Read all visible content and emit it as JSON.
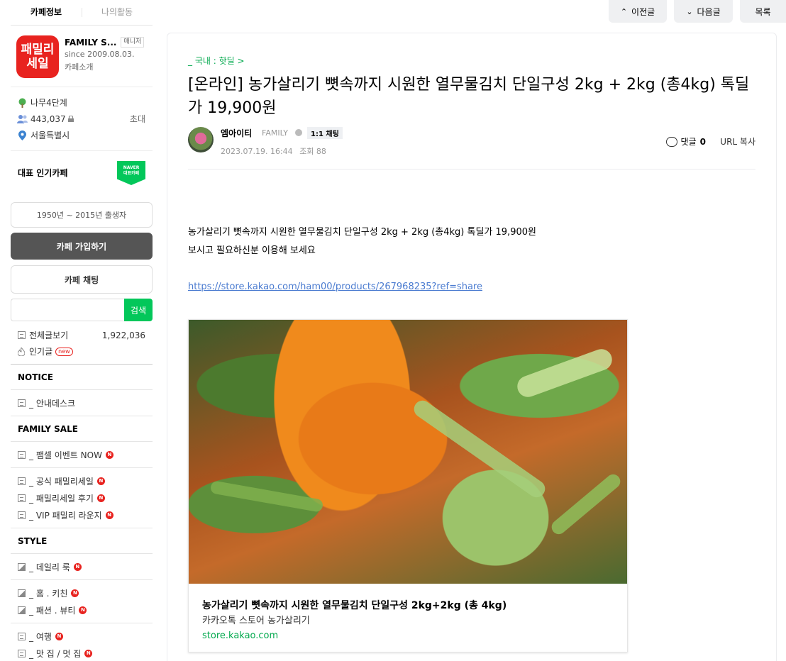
{
  "sidebar": {
    "tabs": [
      "카페정보",
      "나의활동"
    ],
    "cafe": {
      "thumb_lines": [
        "패밀리",
        "세일"
      ],
      "name": "FAMILY S...",
      "badge": "매니저",
      "since": "since 2009.08.03.",
      "intro": "카페소개"
    },
    "stats": {
      "level": "나무4단계",
      "members": "443,037",
      "invite": "초대",
      "location": "서울특별시"
    },
    "rep_label": "대표 인기카페",
    "naver_badge": [
      "NAVER",
      "대표카페"
    ],
    "birth_filter": "1950년 ~ 2015년 출생자",
    "join_label": "카페 가입하기",
    "chat_label": "카페 채팅",
    "search_button": "검색",
    "all_posts_label": "전체글보기",
    "all_posts_count": "1,922,036",
    "popular_label": "인기글",
    "new_badge": "new",
    "sections": [
      {
        "title": "NOTICE"
      },
      {
        "title": "FAMILY SALE"
      },
      {
        "title": "STYLE"
      }
    ],
    "notice_items": [
      "_ 안내데스크"
    ],
    "sale_items_1": [
      "_ 팸셀 이벤트 NOW"
    ],
    "sale_items_2": [
      "_ 공식 패밀리세일",
      "_ 패밀리세일 후기",
      "_ VIP 패밀리 라운지"
    ],
    "style_items_1": [
      "_ 데일리 룩"
    ],
    "style_items_2": [
      "_ 홈 . 키친",
      "_ 패션 . 뷰티"
    ],
    "style_items_3": [
      "_ 여행",
      "_ 맛 집 / 멋 집"
    ],
    "n_badge": "N"
  },
  "nav": {
    "prev": "이전글",
    "next": "다음글",
    "list": "목록"
  },
  "article": {
    "board": "_ 국내 : 핫딜 >",
    "title": "[온라인] 농가살리기 뼛속까지 시원한 열무물김치 단일구성 2kg + 2kg (총4kg) 톡딜가 19,900원",
    "writer": "엠아이티",
    "grade": "FAMILY",
    "chat_chip": "1:1 채팅",
    "date": "2023.07.19. 16:44",
    "views": "조회 88",
    "comment_label": "댓글",
    "comment_count": "0",
    "url_copy": "URL 복사",
    "body_lines": [
      "농가살리기 뼛속까지 시원한 열무물김치 단일구성 2kg + 2kg (총4kg) 톡딜가 19,900원",
      "보시고 필요하신분 이용해 보세요"
    ],
    "link": "https://store.kakao.com/ham00/products/267968235?ref=share",
    "og": {
      "title": "농가살리기 뼛속까지 시원한 열무물김치 단일구성 2kg+2kg (총 4kg)",
      "desc": "카카오톡 스토어 농가살리기",
      "domain": "store.kakao.com"
    }
  }
}
